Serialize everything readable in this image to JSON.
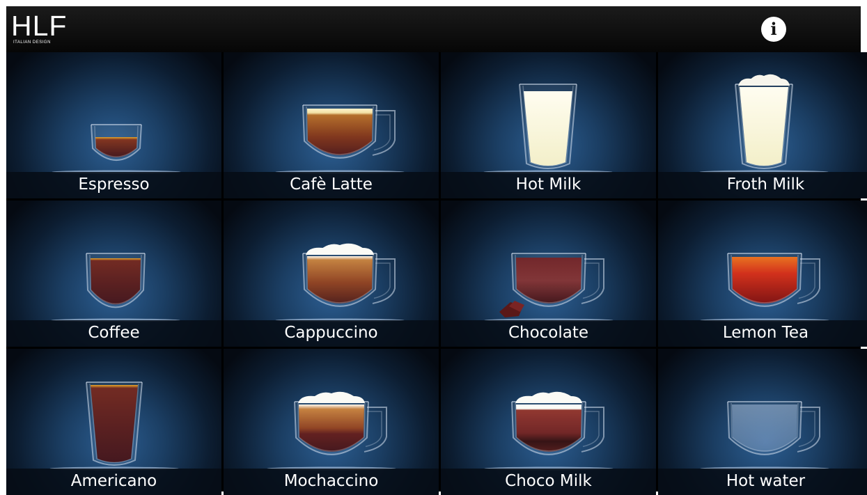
{
  "header": {
    "logo_text": "HLF",
    "logo_subtext": "ITALIAN DESIGN",
    "info_icon": "info-icon"
  },
  "drinks": [
    {
      "label": "Espresso",
      "cup": "espresso",
      "icon": "espresso-cup-icon"
    },
    {
      "label": "Cafè Latte",
      "cup": "latte",
      "icon": "latte-mug-icon"
    },
    {
      "label": "Hot Milk",
      "cup": "hotmilk",
      "icon": "hot-milk-glass-icon"
    },
    {
      "label": "Froth Milk",
      "cup": "frothmilk",
      "icon": "froth-milk-glass-icon"
    },
    {
      "label": "Coffee",
      "cup": "coffee",
      "icon": "coffee-cup-icon"
    },
    {
      "label": "Cappuccino",
      "cup": "cappuccino",
      "icon": "cappuccino-mug-icon"
    },
    {
      "label": "Chocolate",
      "cup": "chocolate",
      "icon": "chocolate-mug-icon"
    },
    {
      "label": "Lemon Tea",
      "cup": "lemontea",
      "icon": "lemon-tea-mug-icon"
    },
    {
      "label": "Americano",
      "cup": "americano",
      "icon": "americano-glass-icon"
    },
    {
      "label": "Mochaccino",
      "cup": "mochaccino",
      "icon": "mochaccino-mug-icon"
    },
    {
      "label": "Choco Milk",
      "cup": "chocomilk",
      "icon": "choco-milk-mug-icon"
    },
    {
      "label": "Hot water",
      "cup": "hotwater",
      "icon": "hot-water-mug-icon"
    }
  ],
  "colors": {
    "tile_glow": "#2c5e92",
    "tile_dark": "#050a12",
    "label_bar": "#060c16",
    "text": "#ffffff"
  }
}
